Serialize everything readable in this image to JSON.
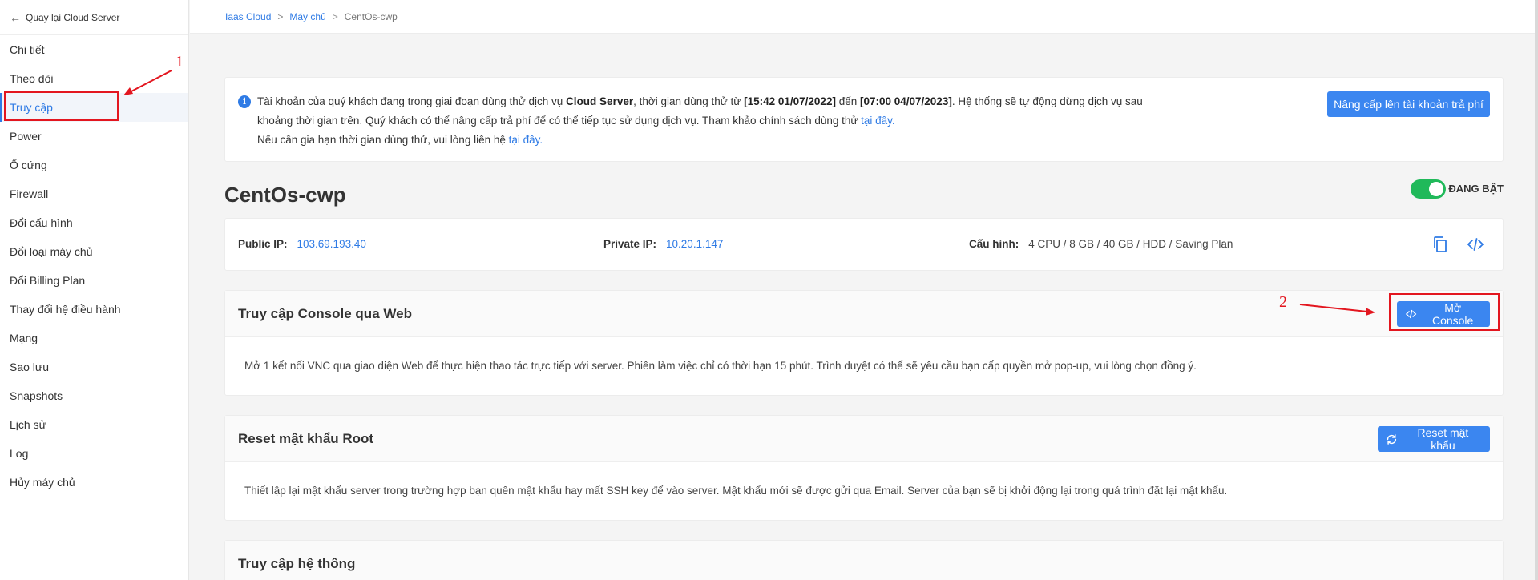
{
  "sidebar": {
    "back_label": "Quay lại Cloud Server",
    "items": [
      {
        "label": "Chi tiết"
      },
      {
        "label": "Theo dõi"
      },
      {
        "label": "Truy cập",
        "active": true
      },
      {
        "label": "Power"
      },
      {
        "label": "Ổ cứng"
      },
      {
        "label": "Firewall"
      },
      {
        "label": "Đổi cấu hình"
      },
      {
        "label": "Đổi loại máy chủ"
      },
      {
        "label": "Đổi Billing Plan"
      },
      {
        "label": "Thay đổi hệ điều hành"
      },
      {
        "label": "Mạng"
      },
      {
        "label": "Sao lưu"
      },
      {
        "label": "Snapshots"
      },
      {
        "label": "Lịch sử"
      },
      {
        "label": "Log"
      },
      {
        "label": "Hủy máy chủ"
      }
    ]
  },
  "breadcrumb": {
    "items": [
      "Iaas Cloud",
      "Máy chủ",
      "CentOs-cwp"
    ],
    "separator": ">"
  },
  "notice": {
    "line1_a": "Tài khoản của quý khách đang trong giai đoạn dùng thử dịch vụ ",
    "line1_service": "Cloud Server",
    "line1_b": ", thời gian dùng thử từ ",
    "line1_start": "[15:42 01/07/2022]",
    "line1_c": " đến ",
    "line1_end": "[07:00 04/07/2023]",
    "line1_d": ". Hệ thống sẽ tự động dừng dịch vụ sau",
    "line2": "khoảng thời gian trên. Quý khách có thể nâng cấp trả phí để có thể tiếp tục sử dụng dịch vụ. Tham khảo chính sách dùng thử ",
    "line2_link": "tại đây.",
    "line3": "Nếu cần gia hạn thời gian dùng thử, vui lòng liên hệ ",
    "line3_link": "tại đây.",
    "upgrade_button": "Nâng cấp lên tài khoản trả phí"
  },
  "server": {
    "name": "CentOs-cwp",
    "status_label": "ĐANG BẬT",
    "status_on": true
  },
  "info": {
    "public_ip_label": "Public IP:",
    "public_ip": "103.69.193.40",
    "private_ip_label": "Private IP:",
    "private_ip": "10.20.1.147",
    "config_label": "Cấu hình:",
    "config": "4 CPU / 8 GB / 40 GB / HDD / Saving Plan"
  },
  "console_section": {
    "title": "Truy cập Console qua Web",
    "button": "Mở Console",
    "description": "Mở 1 kết nối VNC qua giao diện Web để thực hiện thao tác trực tiếp với server. Phiên làm việc chỉ có thời hạn 15 phút. Trình duyệt có thể sẽ yêu cầu bạn cấp quyền mở pop-up, vui lòng chọn đồng ý."
  },
  "reset_section": {
    "title": "Reset mật khẩu Root",
    "button": "Reset mật khẩu",
    "description": "Thiết lập lại mật khẩu server trong trường hợp bạn quên mật khẩu hay mất SSH key để vào server. Mật khẩu mới sẽ được gửi qua Email. Server của bạn sẽ bị khởi động lại trong quá trình đặt lại mật khẩu."
  },
  "system_section": {
    "title": "Truy cập hệ thống"
  },
  "annotations": {
    "step1": "1",
    "step2": "2",
    "color": "#e3161f"
  },
  "colors": {
    "accent": "#2f7be5",
    "button": "#3b86f0",
    "toggle_on": "#20b95a"
  }
}
